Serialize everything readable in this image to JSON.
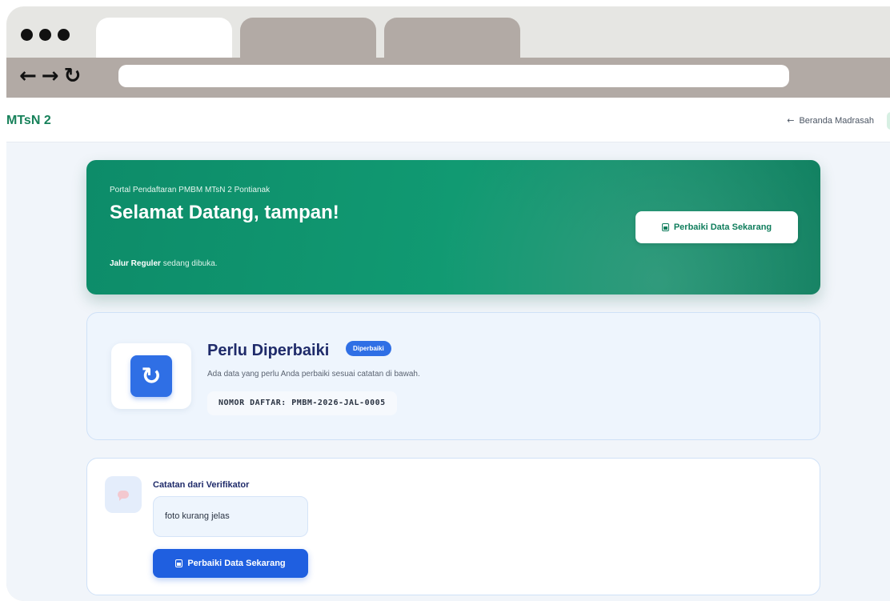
{
  "browser": {
    "tabs": [
      {
        "active": true
      },
      {
        "active": false
      },
      {
        "active": false
      }
    ],
    "nav": {
      "back_icon": "arrow-left-icon",
      "forward_icon": "arrow-right-icon",
      "reload_icon": "reload-icon"
    },
    "url": ""
  },
  "site": {
    "brand": "MTsN 2",
    "home_link": "Beranda Madrasah",
    "home_icon": "arrow-left-icon"
  },
  "hero": {
    "subtitle": "Portal Pendaftaran PMBM MTsN 2 Pontianak",
    "title": "Selamat Datang, tampan!",
    "note_bold": "Jalur Reguler",
    "note_rest": " sedang dibuka.",
    "button_label": "Perbaiki Data Sekarang",
    "button_icon": "document-icon"
  },
  "status": {
    "icon": "refresh-icon",
    "title": "Perlu Diperbaiki",
    "badge": "Diperbaiki",
    "description": "Ada data yang perlu Anda perbaiki sesuai catatan di bawah.",
    "registration_number": "NOMOR DAFTAR: PMBM-2026-JAL-0005"
  },
  "notes": {
    "icon": "chat-bubble-icon",
    "title": "Catatan dari Verifikator",
    "message": "foto kurang jelas",
    "button_label": "Perbaiki Data Sekarang",
    "button_icon": "document-icon"
  },
  "colors": {
    "brand_green": "#0f8a66",
    "primary_blue": "#1f5fe0",
    "title_navy": "#1f2b6a"
  }
}
